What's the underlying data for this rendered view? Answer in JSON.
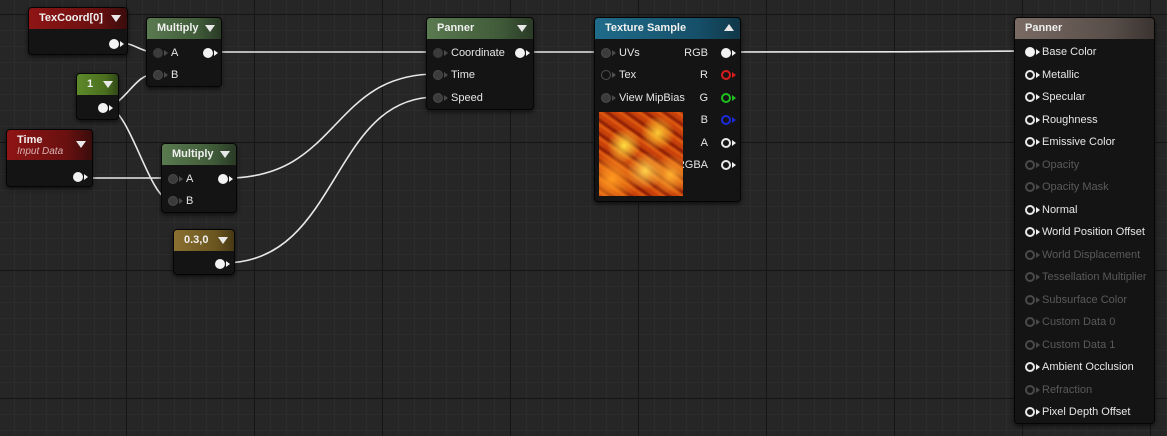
{
  "nodes": {
    "texcoord": {
      "title": "TexCoord[0]"
    },
    "const_one": {
      "title": "1"
    },
    "time": {
      "title": "Time",
      "subtitle": "Input Data"
    },
    "multiply_1": {
      "title": "Multiply",
      "inputs": [
        "A",
        "B"
      ]
    },
    "multiply_2": {
      "title": "Multiply",
      "inputs": [
        "A",
        "B"
      ]
    },
    "const_vec": {
      "title": "0.3,0"
    },
    "panner": {
      "title": "Panner",
      "inputs": [
        "Coordinate",
        "Time",
        "Speed"
      ]
    },
    "texture_sample": {
      "title": "Texture Sample",
      "inputs": [
        "UVs",
        "Tex",
        "View MipBias"
      ],
      "outputs": [
        "RGB",
        "R",
        "G",
        "B",
        "A",
        "RGBA"
      ],
      "preview_icon": "fire-texture-preview"
    },
    "material_result": {
      "title": "Panner",
      "inputs": [
        {
          "label": "Base Color",
          "state": "connected"
        },
        {
          "label": "Metallic",
          "state": "enabled"
        },
        {
          "label": "Specular",
          "state": "enabled"
        },
        {
          "label": "Roughness",
          "state": "enabled"
        },
        {
          "label": "Emissive Color",
          "state": "enabled"
        },
        {
          "label": "Opacity",
          "state": "disabled"
        },
        {
          "label": "Opacity Mask",
          "state": "disabled"
        },
        {
          "label": "Normal",
          "state": "enabled"
        },
        {
          "label": "World Position Offset",
          "state": "enabled"
        },
        {
          "label": "World Displacement",
          "state": "disabled"
        },
        {
          "label": "Tessellation Multiplier",
          "state": "disabled"
        },
        {
          "label": "Subsurface Color",
          "state": "disabled"
        },
        {
          "label": "Custom Data 0",
          "state": "disabled"
        },
        {
          "label": "Custom Data 1",
          "state": "disabled"
        },
        {
          "label": "Ambient Occlusion",
          "state": "enabled"
        },
        {
          "label": "Refraction",
          "state": "disabled"
        },
        {
          "label": "Pixel Depth Offset",
          "state": "enabled"
        }
      ]
    }
  },
  "colors": {
    "grid_bg": "#262626",
    "wire": "#e8e8e8",
    "header_red": "#8f1515",
    "header_green": "#5a7a50",
    "header_lime": "#5e8a2a",
    "header_olive": "#8a7030",
    "header_blue": "#1f6c8a",
    "header_result": "#7a6a64",
    "pin_r": "#d81c1c",
    "pin_g": "#20c020",
    "pin_b": "#1c2ad8"
  }
}
